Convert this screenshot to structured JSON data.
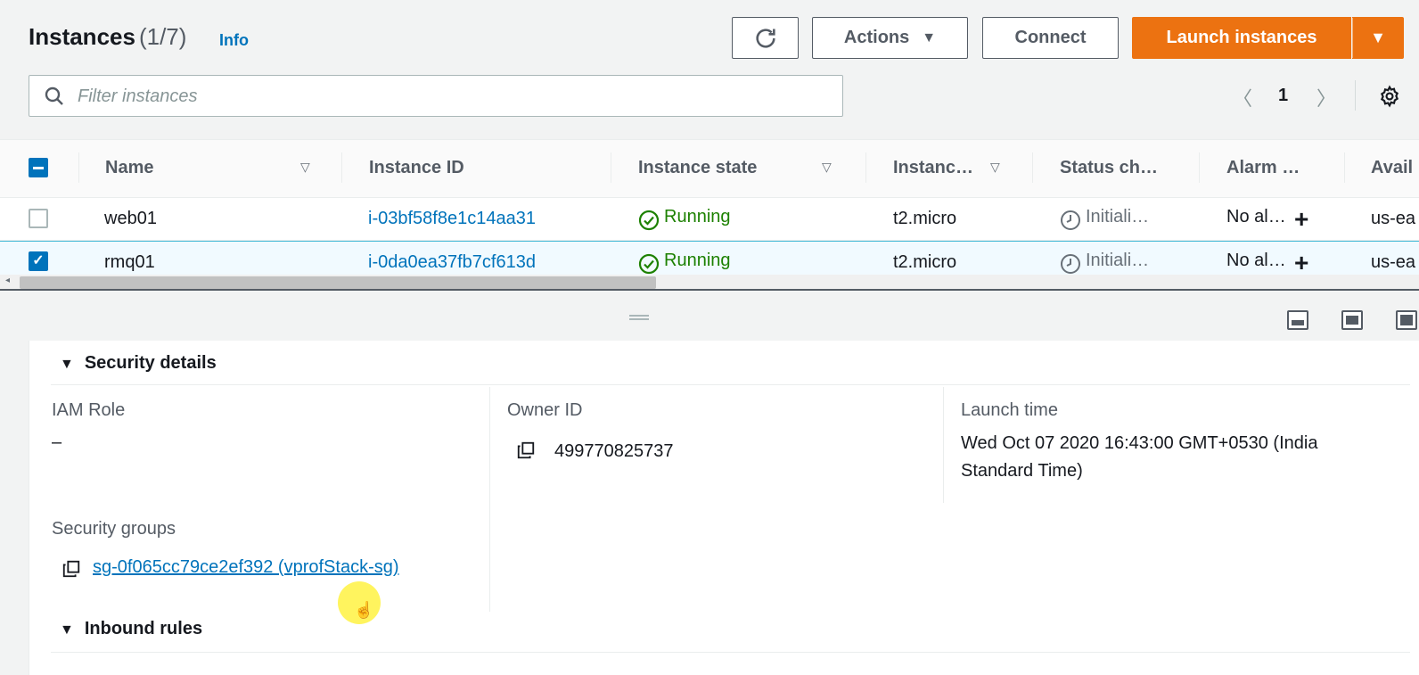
{
  "header": {
    "title": "Instances",
    "count": "(1/7)",
    "info_link": "Info",
    "refresh_icon": "refresh-icon",
    "actions_label": "Actions",
    "connect_label": "Connect",
    "launch_label": "Launch instances",
    "accent_color": "#ec7211"
  },
  "search": {
    "placeholder": "Filter instances",
    "value": ""
  },
  "pagination": {
    "prev": "〈",
    "page": "1",
    "next": "〉"
  },
  "table": {
    "columns": [
      "Name",
      "Instance ID",
      "Instance state",
      "Instanc…",
      "Status ch…",
      "Alarm …",
      "Avail"
    ],
    "rows": [
      {
        "selected": false,
        "name": "web01",
        "instance_id": "i-03bf58f8e1c14aa31",
        "state": "Running",
        "type": "t2.micro",
        "status_check": "Initiali…",
        "alarm": "No al…",
        "az": "us-ea"
      },
      {
        "selected": true,
        "name": "rmq01",
        "instance_id": "i-0da0ea37fb7cf613d",
        "state": "Running",
        "type": "t2.micro",
        "status_check": "Initiali…",
        "alarm": "No al…",
        "az": "us-ea"
      }
    ]
  },
  "details": {
    "security_heading": "Security details",
    "iam_role_label": "IAM Role",
    "iam_role_value": "–",
    "owner_id_label": "Owner ID",
    "owner_id_value": "499770825737",
    "launch_time_label": "Launch time",
    "launch_time_value": "Wed Oct 07 2020 16:43:00 GMT+0530 (India Standard Time)",
    "security_groups_label": "Security groups",
    "security_group_value": "sg-0f065cc79ce2ef392 (vprofStack-sg)",
    "inbound_heading": "Inbound rules"
  }
}
